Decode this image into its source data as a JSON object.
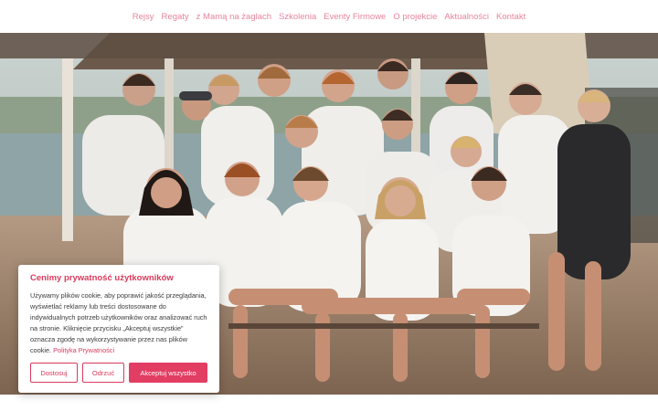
{
  "nav": {
    "items": [
      {
        "label": "Rejsy"
      },
      {
        "label": "Regaty"
      },
      {
        "label": "z Mamą na żaglach"
      },
      {
        "label": "Szkolenia"
      },
      {
        "label": "Eventy Firmowe"
      },
      {
        "label": "O projekcie"
      },
      {
        "label": "Aktualności"
      },
      {
        "label": "Kontakt"
      }
    ]
  },
  "cookie": {
    "title": "Cenimy prywatność użytkowników",
    "body": "Używamy plików cookie, aby poprawić jakość przeglądania, wyświetlać reklamy lub treści dostosowane do indywidualnych potrzeb użytkowników oraz analizować ruch na stronie. Kliknięcie przycisku „Akceptuj wszystkie” oznacza zgodę na wykorzystywanie przez nas plików cookie.",
    "policy_link": "Polityka Prywatności",
    "buttons": {
      "customize": "Dostosuj",
      "reject": "Odrzuć",
      "accept": "Akceptuj wszystko"
    }
  },
  "colors": {
    "accent": "#e23d63",
    "nav_text": "#e8849c"
  }
}
